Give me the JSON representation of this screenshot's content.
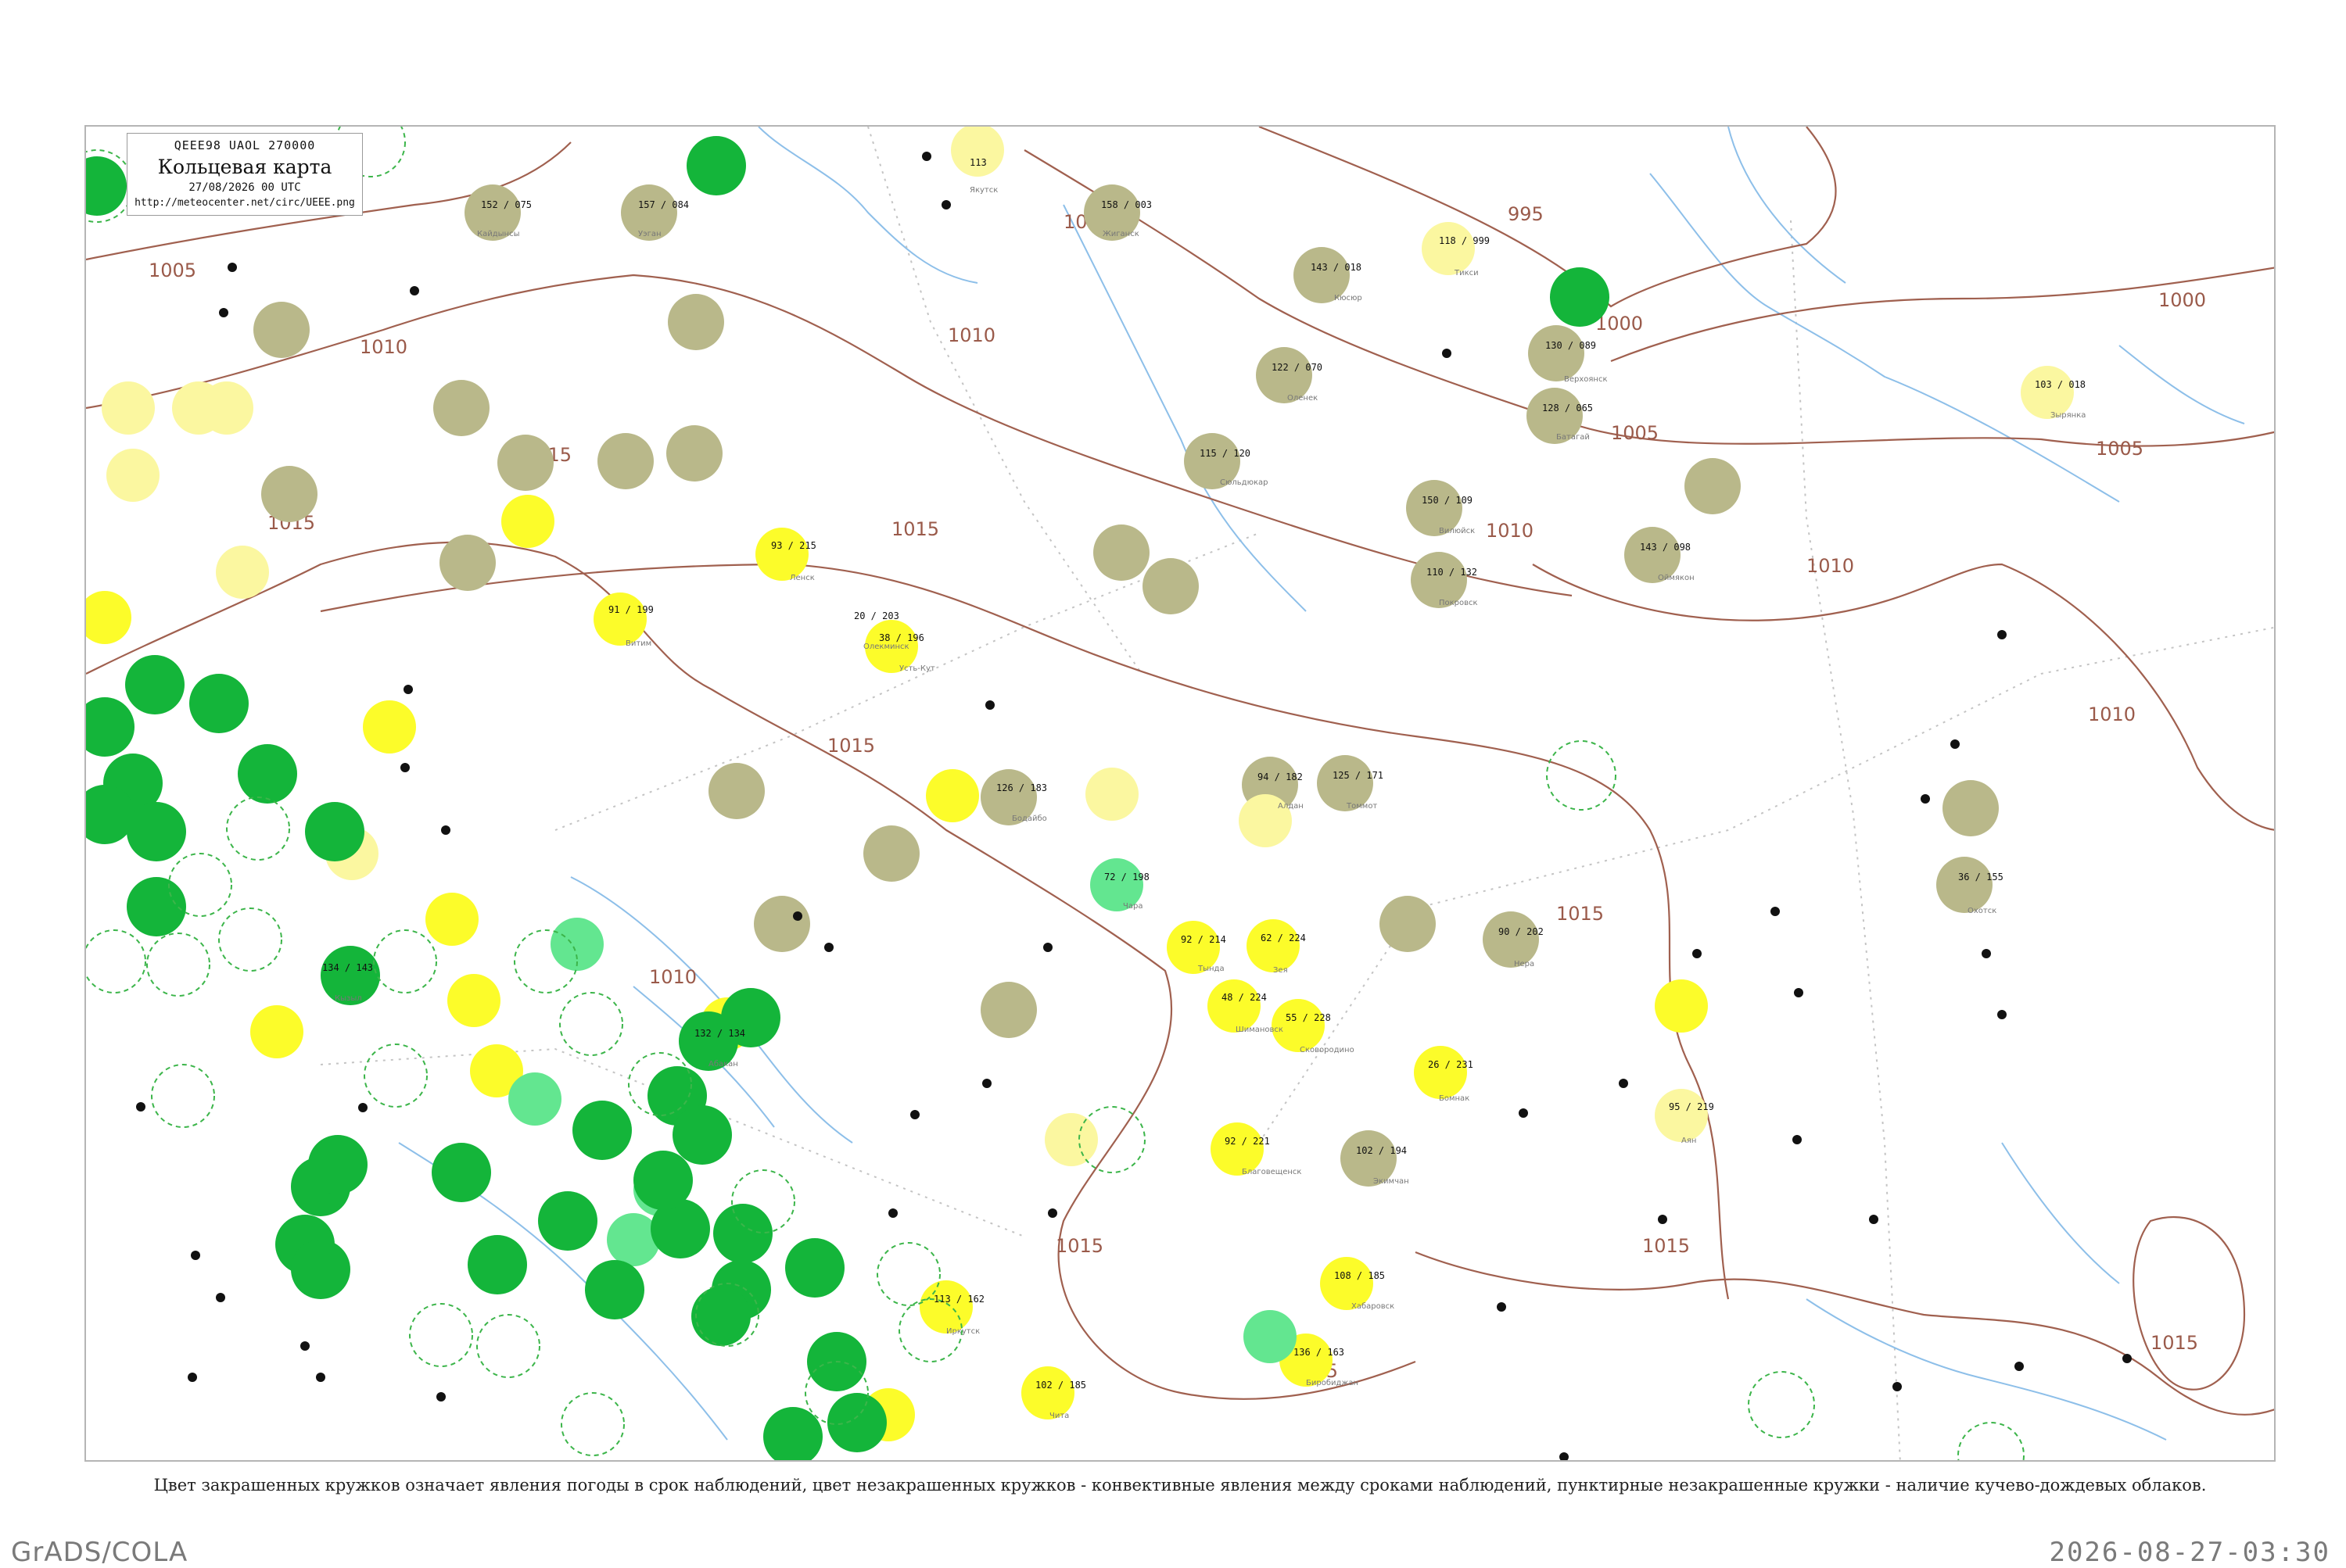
{
  "header": {
    "codes": "QEEE98  UAOL  270000",
    "title": "Кольцевая карта",
    "datetime": "27/08/2026 00 UTC",
    "url": "http://meteocenter.net/circ/UEEE.png"
  },
  "caption": "Цвет закрашенных кружков означает явления погоды в срок наблюдений, цвет незакрашенных кружков - конвективные явления между сроками наблюдений, пунктирные незакрашенные кружки - наличие кучево-дождевых облаков.",
  "footer": {
    "left": "GrADS/COLA",
    "right": "2026-08-27-03:30"
  },
  "colors": {
    "isobar": "#a0604f",
    "river": "#7fb6e6",
    "border": "#b0b0b0",
    "olive": "#b9b88a",
    "yellow": "#fcfc2a",
    "pale_yellow": "#fbf7a0",
    "green": "#14b53a",
    "light_green": "#63e690",
    "dash_circle": "#3cb54a"
  },
  "isobars": [
    {
      "label": "1000"
    },
    {
      "label": "1005"
    },
    {
      "label": "1010"
    },
    {
      "label": "1015"
    },
    {
      "label": "995"
    }
  ],
  "stations": [
    {
      "name": "Кайдынсы",
      "values": "152 / 075",
      "kind": "olive"
    },
    {
      "name": "Уэган",
      "values": "157 / 084",
      "kind": "olive"
    },
    {
      "name": "Якутск",
      "values": "113",
      "kind": "pale_yellow"
    },
    {
      "name": "Жиганск",
      "values": "158 / 003",
      "kind": "olive"
    },
    {
      "name": "Тикси",
      "values": "118 / 999",
      "kind": "pale_yellow"
    },
    {
      "name": "Кюсюр",
      "values": "143 / 018",
      "kind": "olive"
    },
    {
      "name": "Оленек",
      "values": "122 / 070",
      "kind": "olive"
    },
    {
      "name": "Сюльдюкар",
      "values": "115 / 120",
      "kind": "olive"
    },
    {
      "name": "Верхоянск",
      "values": "130 / 089",
      "kind": "olive"
    },
    {
      "name": "Батагай",
      "values": "128 / 065",
      "kind": "olive"
    },
    {
      "name": "Зырянка",
      "values": "103 / 018",
      "kind": "pale_yellow"
    },
    {
      "name": "Вилюйск",
      "values": "150 / 109",
      "kind": "olive"
    },
    {
      "name": "Покровск",
      "values": "110 / 132",
      "kind": "olive"
    },
    {
      "name": "Оймякон",
      "values": "143 / 098",
      "kind": "olive"
    },
    {
      "name": "Олекминск",
      "values": "20 / 203",
      "kind": "yellow"
    },
    {
      "name": "Витим",
      "values": "91 / 199",
      "kind": "yellow"
    },
    {
      "name": "Ленск",
      "values": "93 / 215",
      "kind": "yellow"
    },
    {
      "name": "Усть-Кут",
      "values": "38 / 196",
      "kind": "yellow"
    },
    {
      "name": "Бодайбо",
      "values": "126 / 183",
      "kind": "olive"
    },
    {
      "name": "Алдан",
      "values": "94 / 182",
      "kind": "olive"
    },
    {
      "name": "Томмот",
      "values": "125 / 171",
      "kind": "olive"
    },
    {
      "name": "Чара",
      "values": "72 / 198",
      "kind": "light_green"
    },
    {
      "name": "Тында",
      "values": "92 / 214",
      "kind": "yellow"
    },
    {
      "name": "Зея",
      "values": "62 / 224",
      "kind": "yellow"
    },
    {
      "name": "Нера",
      "values": "90 / 202",
      "kind": "olive"
    },
    {
      "name": "Охотск",
      "values": "36 / 155",
      "kind": "olive"
    },
    {
      "name": "Шимановск",
      "values": "48 / 224",
      "kind": "yellow"
    },
    {
      "name": "Сковородино",
      "values": "55 / 228",
      "kind": "yellow"
    },
    {
      "name": "Благовещенск",
      "values": "92 / 221",
      "kind": "yellow"
    },
    {
      "name": "Экимчан",
      "values": "102 / 194",
      "kind": "olive"
    },
    {
      "name": "Бомнак",
      "values": "26 / 231",
      "kind": "yellow"
    },
    {
      "name": "Аян",
      "values": "95 / 219",
      "kind": "pale_yellow"
    },
    {
      "name": "Хабаровск",
      "values": "108 / 185",
      "kind": "yellow"
    },
    {
      "name": "Биробиджан",
      "values": "136 / 163",
      "kind": "yellow"
    },
    {
      "name": "Иркутск",
      "values": "113 / 162",
      "kind": "yellow"
    },
    {
      "name": "Чита",
      "values": "102 / 185",
      "kind": "yellow"
    },
    {
      "name": "Кызыл",
      "values": "134 / 143",
      "kind": "green"
    },
    {
      "name": "Абакан",
      "values": "132 / 134",
      "kind": "green"
    }
  ]
}
